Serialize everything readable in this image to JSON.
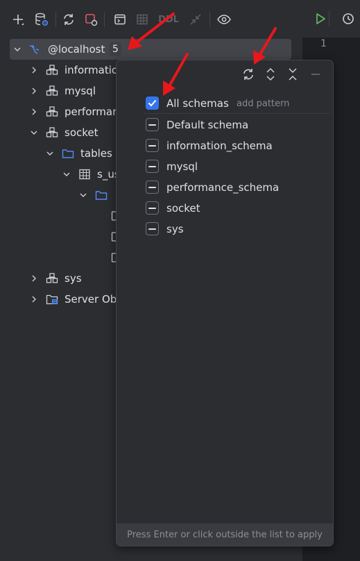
{
  "toolbar": {
    "items": [
      {
        "name": "add",
        "icon": "plus-icon"
      },
      {
        "name": "data-source-properties",
        "icon": "database-settings-icon"
      },
      {
        "name": "refresh",
        "icon": "refresh-icon"
      },
      {
        "name": "stop",
        "icon": "stop-icon"
      },
      {
        "name": "jump-to-console",
        "icon": "console-icon"
      },
      {
        "name": "table-view",
        "icon": "table-icon"
      },
      {
        "name": "ddl",
        "label": "DDL"
      },
      {
        "name": "compare",
        "icon": "compare-arrows-icon"
      },
      {
        "name": "view-options",
        "icon": "eye-icon"
      }
    ]
  },
  "tree": {
    "root": {
      "label": "@localhost",
      "badge": "5"
    },
    "items": [
      {
        "label": "informatio",
        "type": "schema",
        "expanded": false
      },
      {
        "label": "mysql",
        "type": "schema",
        "expanded": false
      },
      {
        "label": "performar",
        "type": "schema",
        "expanded": false
      },
      {
        "label": "socket",
        "type": "schema",
        "expanded": true
      },
      {
        "label": "tables",
        "type": "folder",
        "expanded": true
      },
      {
        "label": "s_us",
        "type": "table",
        "expanded": true
      },
      {
        "label": "",
        "type": "folder",
        "expanded": true
      },
      {
        "label": "sys",
        "type": "schema",
        "expanded": false
      },
      {
        "label": "Server Ob",
        "type": "server-objects",
        "expanded": false
      }
    ]
  },
  "editor": {
    "line_number": "1"
  },
  "popup": {
    "all_schemas_label": "All schemas",
    "add_pattern_label": "add pattern",
    "schemas": [
      {
        "label": "Default schema",
        "state": "partial"
      },
      {
        "label": "information_schema",
        "state": "partial"
      },
      {
        "label": "mysql",
        "state": "partial"
      },
      {
        "label": "performance_schema",
        "state": "partial"
      },
      {
        "label": "socket",
        "state": "partial"
      },
      {
        "label": "sys",
        "state": "partial"
      }
    ],
    "footer": "Press Enter or click outside the list to apply"
  },
  "colors": {
    "background": "#2b2d30",
    "editor_background": "#1e1f22",
    "accent_blue": "#3574f0",
    "folder_blue": "#548af7",
    "run_green": "#5fb865",
    "stop_red": "#e55765",
    "annotation_red": "#e8171c"
  }
}
